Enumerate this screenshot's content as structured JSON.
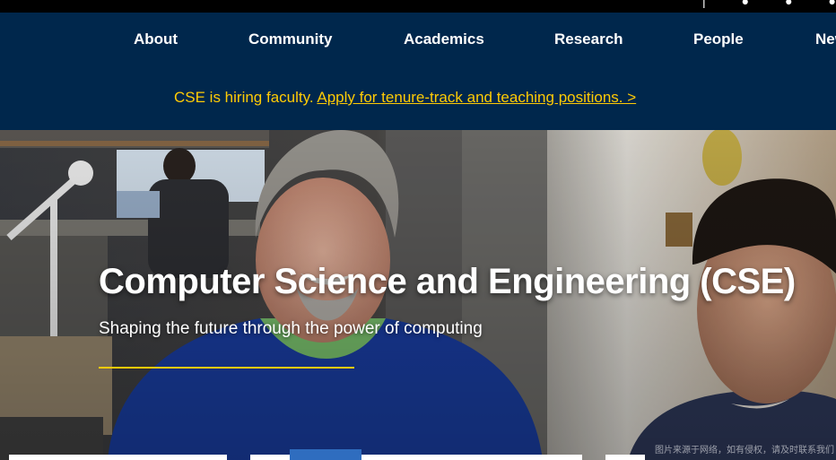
{
  "nav": {
    "items": [
      {
        "label": "About"
      },
      {
        "label": "Community"
      },
      {
        "label": "Academics"
      },
      {
        "label": "Research"
      },
      {
        "label": "People"
      },
      {
        "label": "News"
      }
    ]
  },
  "alert": {
    "prefix": "CSE is hiring faculty.",
    "link": "Apply for tenure-track and teaching positions. >"
  },
  "hero": {
    "title": "Computer Science and Engineering (CSE)",
    "subtitle": "Shaping the future through the power of computing"
  },
  "watermark": "图片来源于网络，如有侵权，请及时联系我们",
  "colors": {
    "navy": "#00274c",
    "maize": "#ffcb05",
    "black": "#000000"
  }
}
